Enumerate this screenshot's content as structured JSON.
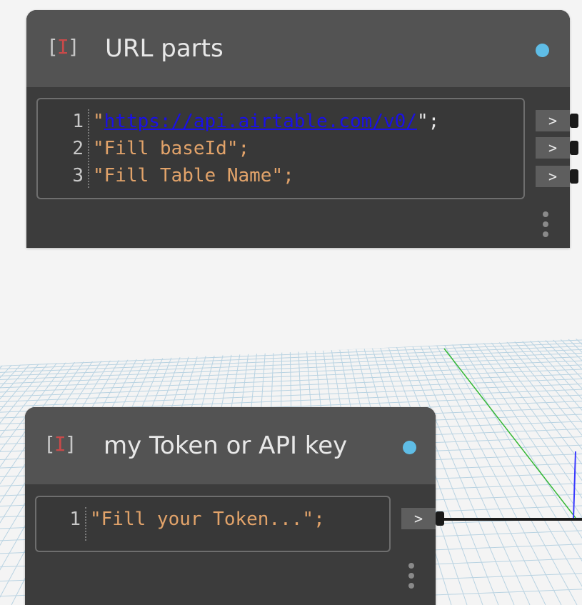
{
  "nodes": {
    "url_parts": {
      "title": "URL parts",
      "lines": [
        {
          "num": "1",
          "prefix": "\"",
          "link": "https://api.airtable.com/v0/",
          "suffix": "\";"
        },
        {
          "num": "2",
          "text": "\"Fill baseId\";"
        },
        {
          "num": "3",
          "text": "\"Fill Table Name\";"
        }
      ]
    },
    "token": {
      "title": "my Token or API key",
      "lines": [
        {
          "num": "1",
          "text": "\"Fill your Token...\";"
        }
      ]
    }
  },
  "ports": {
    "output_label": ">"
  },
  "node_icon": {
    "open": "[",
    "cursor": "I",
    "close": "]"
  },
  "colors": {
    "status_dot": "#5fbde6",
    "string_literal": "#e2a36a",
    "link": "#1a10e8",
    "grid_line": "#b9d3e2",
    "axis_green": "#36b836",
    "axis_blue": "#3a3aff",
    "wire": "#1a1a1a"
  }
}
